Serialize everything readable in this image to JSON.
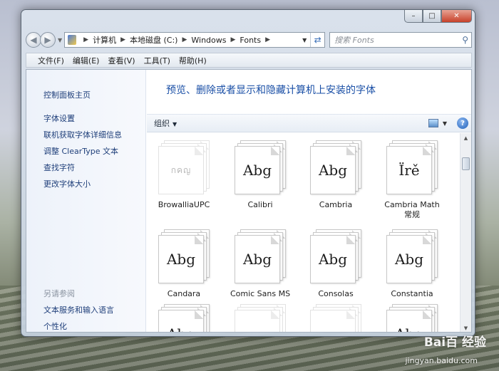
{
  "window": {
    "caption_buttons": {
      "minimize": "–",
      "maximize": "□",
      "close": "✕"
    }
  },
  "navigation": {
    "back_icon": "back-arrow-icon",
    "forward_icon": "forward-arrow-icon",
    "crumbs": [
      "计算机",
      "本地磁盘 (C:)",
      "Windows",
      "Fonts"
    ],
    "search_placeholder": "搜索 Fonts"
  },
  "menu": [
    "文件(F)",
    "编辑(E)",
    "查看(V)",
    "工具(T)",
    "帮助(H)"
  ],
  "left_pane": {
    "home_link": "控制面板主页",
    "links": [
      "字体设置",
      "联机获取字体详细信息",
      "调整 ClearType 文本",
      "查找字符",
      "更改字体大小"
    ],
    "see_also_heading": "另请参阅",
    "see_also_links": [
      "文本服务和输入语言",
      "个性化"
    ]
  },
  "main": {
    "title": "预览、删除或者显示和隐藏计算机上安装的字体",
    "organize_label": "组织",
    "help_glyph": "?"
  },
  "fonts": [
    {
      "name": "BrowalliaUPC",
      "sample": "กคญ",
      "dim": true
    },
    {
      "name": "Calibri",
      "sample": "Abg",
      "dim": false
    },
    {
      "name": "Cambria",
      "sample": "Abg",
      "dim": false
    },
    {
      "name": "Cambria Math",
      "sub": "常规",
      "sample": "Ïrě",
      "dim": false
    },
    {
      "name": "Candara",
      "sample": "Abg",
      "dim": false
    },
    {
      "name": "Comic Sans MS",
      "sample": "Abg",
      "dim": false
    },
    {
      "name": "Consolas",
      "sample": "Abg",
      "dim": false
    },
    {
      "name": "Constantia",
      "sample": "Abg",
      "dim": false
    },
    {
      "name": "",
      "sample": "Abg",
      "dim": false
    },
    {
      "name": "",
      "sample": "กคญ",
      "dim": true
    },
    {
      "name": "",
      "sample": "กคญ",
      "dim": true
    },
    {
      "name": "",
      "sample": "Abg",
      "dim": false
    }
  ],
  "watermark": {
    "text": "Bai百 经验",
    "url": "jingyan.baidu.com"
  }
}
